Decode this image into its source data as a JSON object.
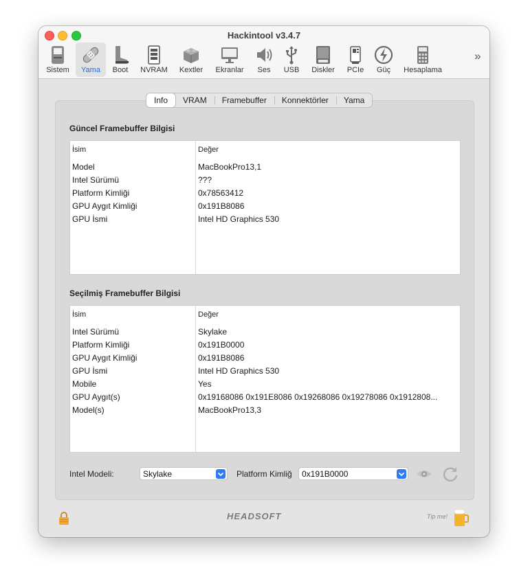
{
  "window": {
    "title": "Hackintool v3.4.7"
  },
  "toolbar": {
    "items": [
      {
        "label": "Sistem",
        "icon": "computer-icon"
      },
      {
        "label": "Yama",
        "icon": "bandage-icon",
        "selected": true
      },
      {
        "label": "Boot",
        "icon": "boot-icon"
      },
      {
        "label": "NVRAM",
        "icon": "memory-icon"
      },
      {
        "label": "Kextler",
        "icon": "lego-brick-icon"
      },
      {
        "label": "Ekranlar",
        "icon": "display-icon"
      },
      {
        "label": "Ses",
        "icon": "speaker-icon"
      },
      {
        "label": "USB",
        "icon": "usb-icon"
      },
      {
        "label": "Diskler",
        "icon": "disk-icon"
      },
      {
        "label": "PCIe",
        "icon": "pcie-icon"
      },
      {
        "label": "Güç",
        "icon": "power-icon"
      },
      {
        "label": "Hesaplama",
        "icon": "calculator-icon"
      }
    ],
    "more": "»"
  },
  "tabs": [
    "Info",
    "VRAM",
    "Framebuffer",
    "Konnektörler",
    "Yama"
  ],
  "current": {
    "title": "Güncel Framebuffer Bilgisi",
    "headers": [
      "İsim",
      "Değer"
    ],
    "rows": [
      [
        "Model",
        "MacBookPro13,1"
      ],
      [
        "Intel Sürümü",
        "???"
      ],
      [
        "Platform Kimliği",
        "0x78563412"
      ],
      [
        "GPU Aygıt Kimliği",
        "0x191B8086"
      ],
      [
        "GPU İsmi",
        "Intel HD Graphics 530"
      ]
    ]
  },
  "selected": {
    "title": "Seçilmiş Framebuffer Bilgisi",
    "headers": [
      "İsim",
      "Değer"
    ],
    "rows": [
      [
        "Intel Sürümü",
        "Skylake"
      ],
      [
        "Platform Kimliği",
        "0x191B0000"
      ],
      [
        "GPU Aygıt Kimliği",
        "0x191B8086"
      ],
      [
        "GPU İsmi",
        "Intel HD Graphics 530"
      ],
      [
        "Mobile",
        "Yes"
      ],
      [
        "GPU Aygıt(s)",
        "0x19168086 0x191E8086 0x19268086 0x19278086 0x1912808..."
      ],
      [
        "Model(s)",
        "MacBookPro13,3"
      ]
    ]
  },
  "bottom": {
    "intel_label": "Intel Modeli:",
    "intel_value": "Skylake",
    "platform_label": "Platform Kimliğ",
    "platform_value": "0x191B0000"
  },
  "footer": {
    "logo": "HEADSOFT",
    "tip": "Tip me!"
  }
}
